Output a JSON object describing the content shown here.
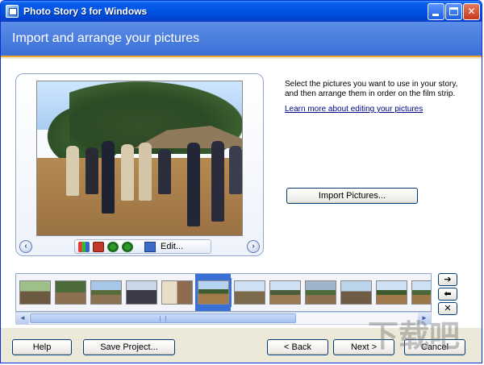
{
  "window": {
    "title": "Photo Story 3 for Windows",
    "min_label": "",
    "max_label": "",
    "close_label": "✕"
  },
  "header": {
    "title": "Import and arrange your pictures"
  },
  "preview": {
    "prev_label": "‹",
    "next_label": "›",
    "edit_label": "Edit..."
  },
  "instructions": {
    "text": "Select the pictures you want to use in your story, and then arrange them in order on the film strip.",
    "link_text": "Learn more about editing your pictures"
  },
  "import_button": "Import Pictures...",
  "filmstrip": {
    "selected_index": 5,
    "thumb_count": 12,
    "scroll_left": "◄",
    "scroll_right": "►"
  },
  "side_buttons": {
    "move_right": "➔",
    "move_left": "⬅",
    "remove": "✕"
  },
  "bottom": {
    "help": "Help",
    "save_project": "Save Project...",
    "back": "< Back",
    "next": "Next >",
    "cancel": "Cancel"
  },
  "watermark": "下载吧",
  "colors": {
    "titlebar": "#0055e5",
    "header": "#4a7fdc",
    "accent": "#f2a52b"
  }
}
